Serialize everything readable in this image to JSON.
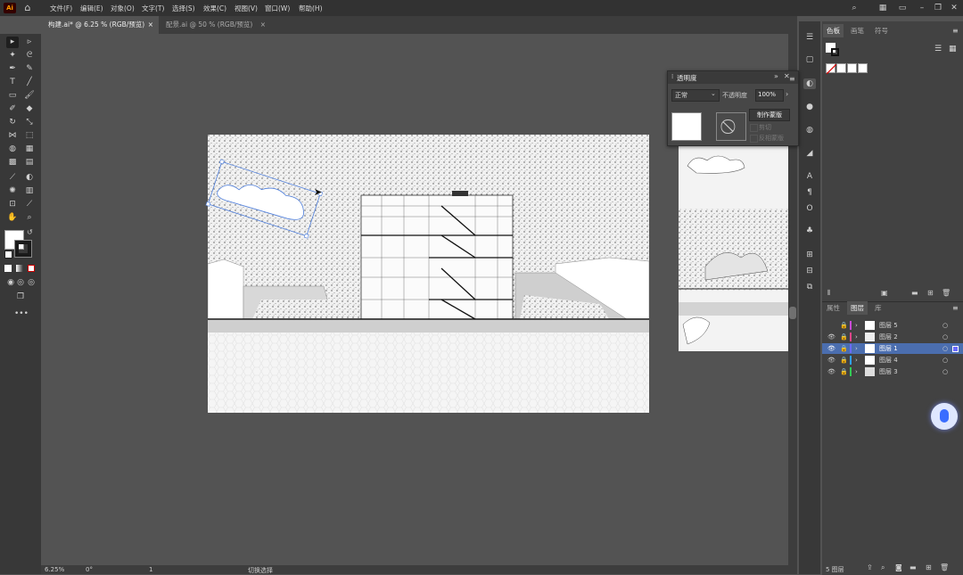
{
  "app": {
    "logo": "Ai"
  },
  "menu": [
    "文件(F)",
    "编辑(E)",
    "对象(O)",
    "文字(T)",
    "选择(S)",
    "效果(C)",
    "视图(V)",
    "窗口(W)",
    "帮助(H)"
  ],
  "tabs": [
    {
      "label": "构建.ai* @ 6.25 % (RGB/预览)",
      "close": "×"
    },
    {
      "label": "配景.ai @ 50 % (RGB/预览)",
      "close": "×"
    }
  ],
  "status": {
    "zoom": "6.25%",
    "rotate": "0°",
    "page": "1",
    "tool": "切换选择"
  },
  "panels": {
    "swatch_tabs": [
      "色板",
      "画笔",
      "符号"
    ],
    "layer_tabs": [
      "属性",
      "图层",
      "库"
    ],
    "layer_count": "5 图层"
  },
  "layers": [
    {
      "name": "图层 5",
      "color": "#c84bd6"
    },
    {
      "name": "图层 2",
      "color": "#e0468a"
    },
    {
      "name": "图层 1",
      "color": "#6a6aff"
    },
    {
      "name": "图层 4",
      "color": "#2fa0ff"
    },
    {
      "name": "图层 3",
      "color": "#33cc55"
    }
  ],
  "transparency": {
    "title": "透明度",
    "blend_mode": "正常",
    "opacity_label": "不透明度",
    "opacity_value": "100%",
    "make_mask": "制作蒙版",
    "clip": "剪切",
    "invert": "反相蒙版"
  },
  "colors": {
    "accent": "#4b6eaf",
    "selection": "#4f7fdc"
  }
}
